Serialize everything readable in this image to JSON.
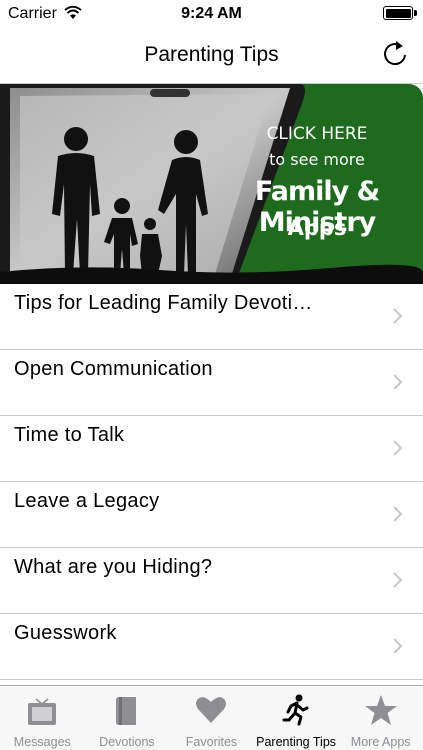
{
  "status_bar": {
    "carrier": "Carrier",
    "time": "9:24 AM"
  },
  "nav": {
    "title": "Parenting Tips",
    "refresh_icon": "refresh-icon"
  },
  "banner": {
    "line1": "CLICK HERE",
    "line2": "to see more",
    "line3": "Family & Ministry",
    "line4": "Apps",
    "accent_color": "#1e6b1e"
  },
  "list": {
    "items": [
      {
        "label": "Tips for Leading Family Devoti…"
      },
      {
        "label": "Open Communication"
      },
      {
        "label": "Time to Talk"
      },
      {
        "label": "Leave a Legacy"
      },
      {
        "label": "What are you Hiding?"
      },
      {
        "label": "Guesswork"
      }
    ]
  },
  "tab_bar": {
    "tabs": [
      {
        "label": "Messages",
        "icon": "tv-icon",
        "active": false
      },
      {
        "label": "Devotions",
        "icon": "book-icon",
        "active": false
      },
      {
        "label": "Favorites",
        "icon": "heart-icon",
        "active": false
      },
      {
        "label": "Parenting Tips",
        "icon": "running-figure-icon",
        "active": true
      },
      {
        "label": "More Apps",
        "icon": "star-icon",
        "active": false
      }
    ]
  }
}
